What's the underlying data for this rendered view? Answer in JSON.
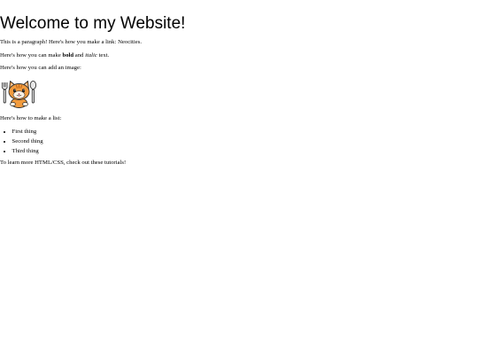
{
  "heading": "Welcome to my Website!",
  "paragraph_link": {
    "prefix": "This is a paragraph! Here's how you make a link: ",
    "link_text": "Neocities",
    "suffix": "."
  },
  "paragraph_format": {
    "prefix": "Here's how you can make ",
    "bold_text": "bold",
    "middle": " and ",
    "italic_text": "italic",
    "suffix": " text."
  },
  "paragraph_image": "Here's how you can add an image:",
  "image_icon": "neocities-cat-mascot-icon",
  "paragraph_list": "Here's how to make a list:",
  "list_items": [
    "First thing",
    "Second thing",
    "Third thing"
  ],
  "paragraph_tutorials": {
    "prefix": "To learn more HTML/CSS, check out these ",
    "link_text": "tutorials",
    "suffix": "!"
  }
}
